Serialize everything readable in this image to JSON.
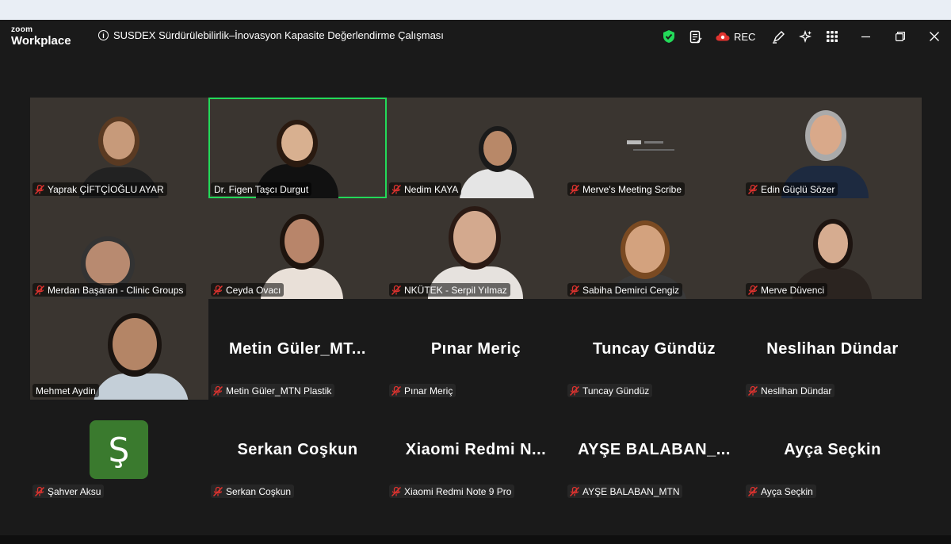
{
  "app": {
    "brand_top": "zoom",
    "brand_bottom": "Workplace",
    "meeting_title": "SUSDEX Sürdürülebilirlik–İnovasyon Kapasite Değerlendirme Çalışması",
    "rec_label": "REC"
  },
  "colors": {
    "background": "#1a1a1a",
    "active_speaker": "#23d959",
    "muted": "#e0332f",
    "avatar": "#3a7a2e",
    "shield": "#23d959",
    "rec_cloud": "#e0332f"
  },
  "participants": [
    {
      "name": "Yaprak ÇİFTÇİOĞLU AYAR",
      "video": true,
      "muted": true
    },
    {
      "name": "Dr. Figen Taşcı Durgut",
      "video": true,
      "muted": false,
      "active": true
    },
    {
      "name": "Nedim KAYA",
      "video": true,
      "muted": true
    },
    {
      "name": "Merve's Meeting Scribe",
      "video": true,
      "muted": true
    },
    {
      "name": "Edin Güçlü Sözer",
      "video": true,
      "muted": true
    },
    {
      "name": "Merdan Başaran - Clinic Groups",
      "video": true,
      "muted": true
    },
    {
      "name": "Ceyda Ovacı",
      "video": true,
      "muted": true
    },
    {
      "name": "NKÜTEK - Serpil Yılmaz",
      "video": true,
      "muted": true
    },
    {
      "name": "Sabiha Demirci Cengiz",
      "video": true,
      "muted": true
    },
    {
      "name": "Merve Düvenci",
      "video": true,
      "muted": true
    },
    {
      "name": "Mehmet Aydin",
      "video": true,
      "muted": false
    },
    {
      "name": "Metin Güler_MTN Plastik",
      "display": "Metin  Güler_MT...",
      "video": false,
      "muted": true
    },
    {
      "name": "Pınar Meriç",
      "display": "Pınar Meriç",
      "video": false,
      "muted": true
    },
    {
      "name": "Tuncay Gündüz",
      "display": "Tuncay Gündüz",
      "video": false,
      "muted": true
    },
    {
      "name": "Neslihan Dündar",
      "display": "Neslihan Dündar",
      "video": false,
      "muted": true
    },
    {
      "name": "Şahver Aksu",
      "avatar_letter": "Ş",
      "video": false,
      "muted": true
    },
    {
      "name": "Serkan Coşkun",
      "display": "Serkan Coşkun",
      "video": false,
      "muted": true
    },
    {
      "name": "Xiaomi Redmi Note 9 Pro",
      "display": "Xiaomi  Redmi  N...",
      "video": false,
      "muted": true
    },
    {
      "name": "AYŞE BALABAN_MTN",
      "display": "AYŞE  BALABAN_...",
      "video": false,
      "muted": true
    },
    {
      "name": "Ayça Seçkin",
      "display": "Ayça Seçkin",
      "video": false,
      "muted": true
    }
  ],
  "toolbar_icons": [
    "shield-icon",
    "notes-icon",
    "rec-cloud-icon",
    "annotate-icon",
    "ai-companion-icon",
    "apps-icon"
  ],
  "window_controls": [
    "minimize-icon",
    "restore-icon",
    "close-icon"
  ]
}
